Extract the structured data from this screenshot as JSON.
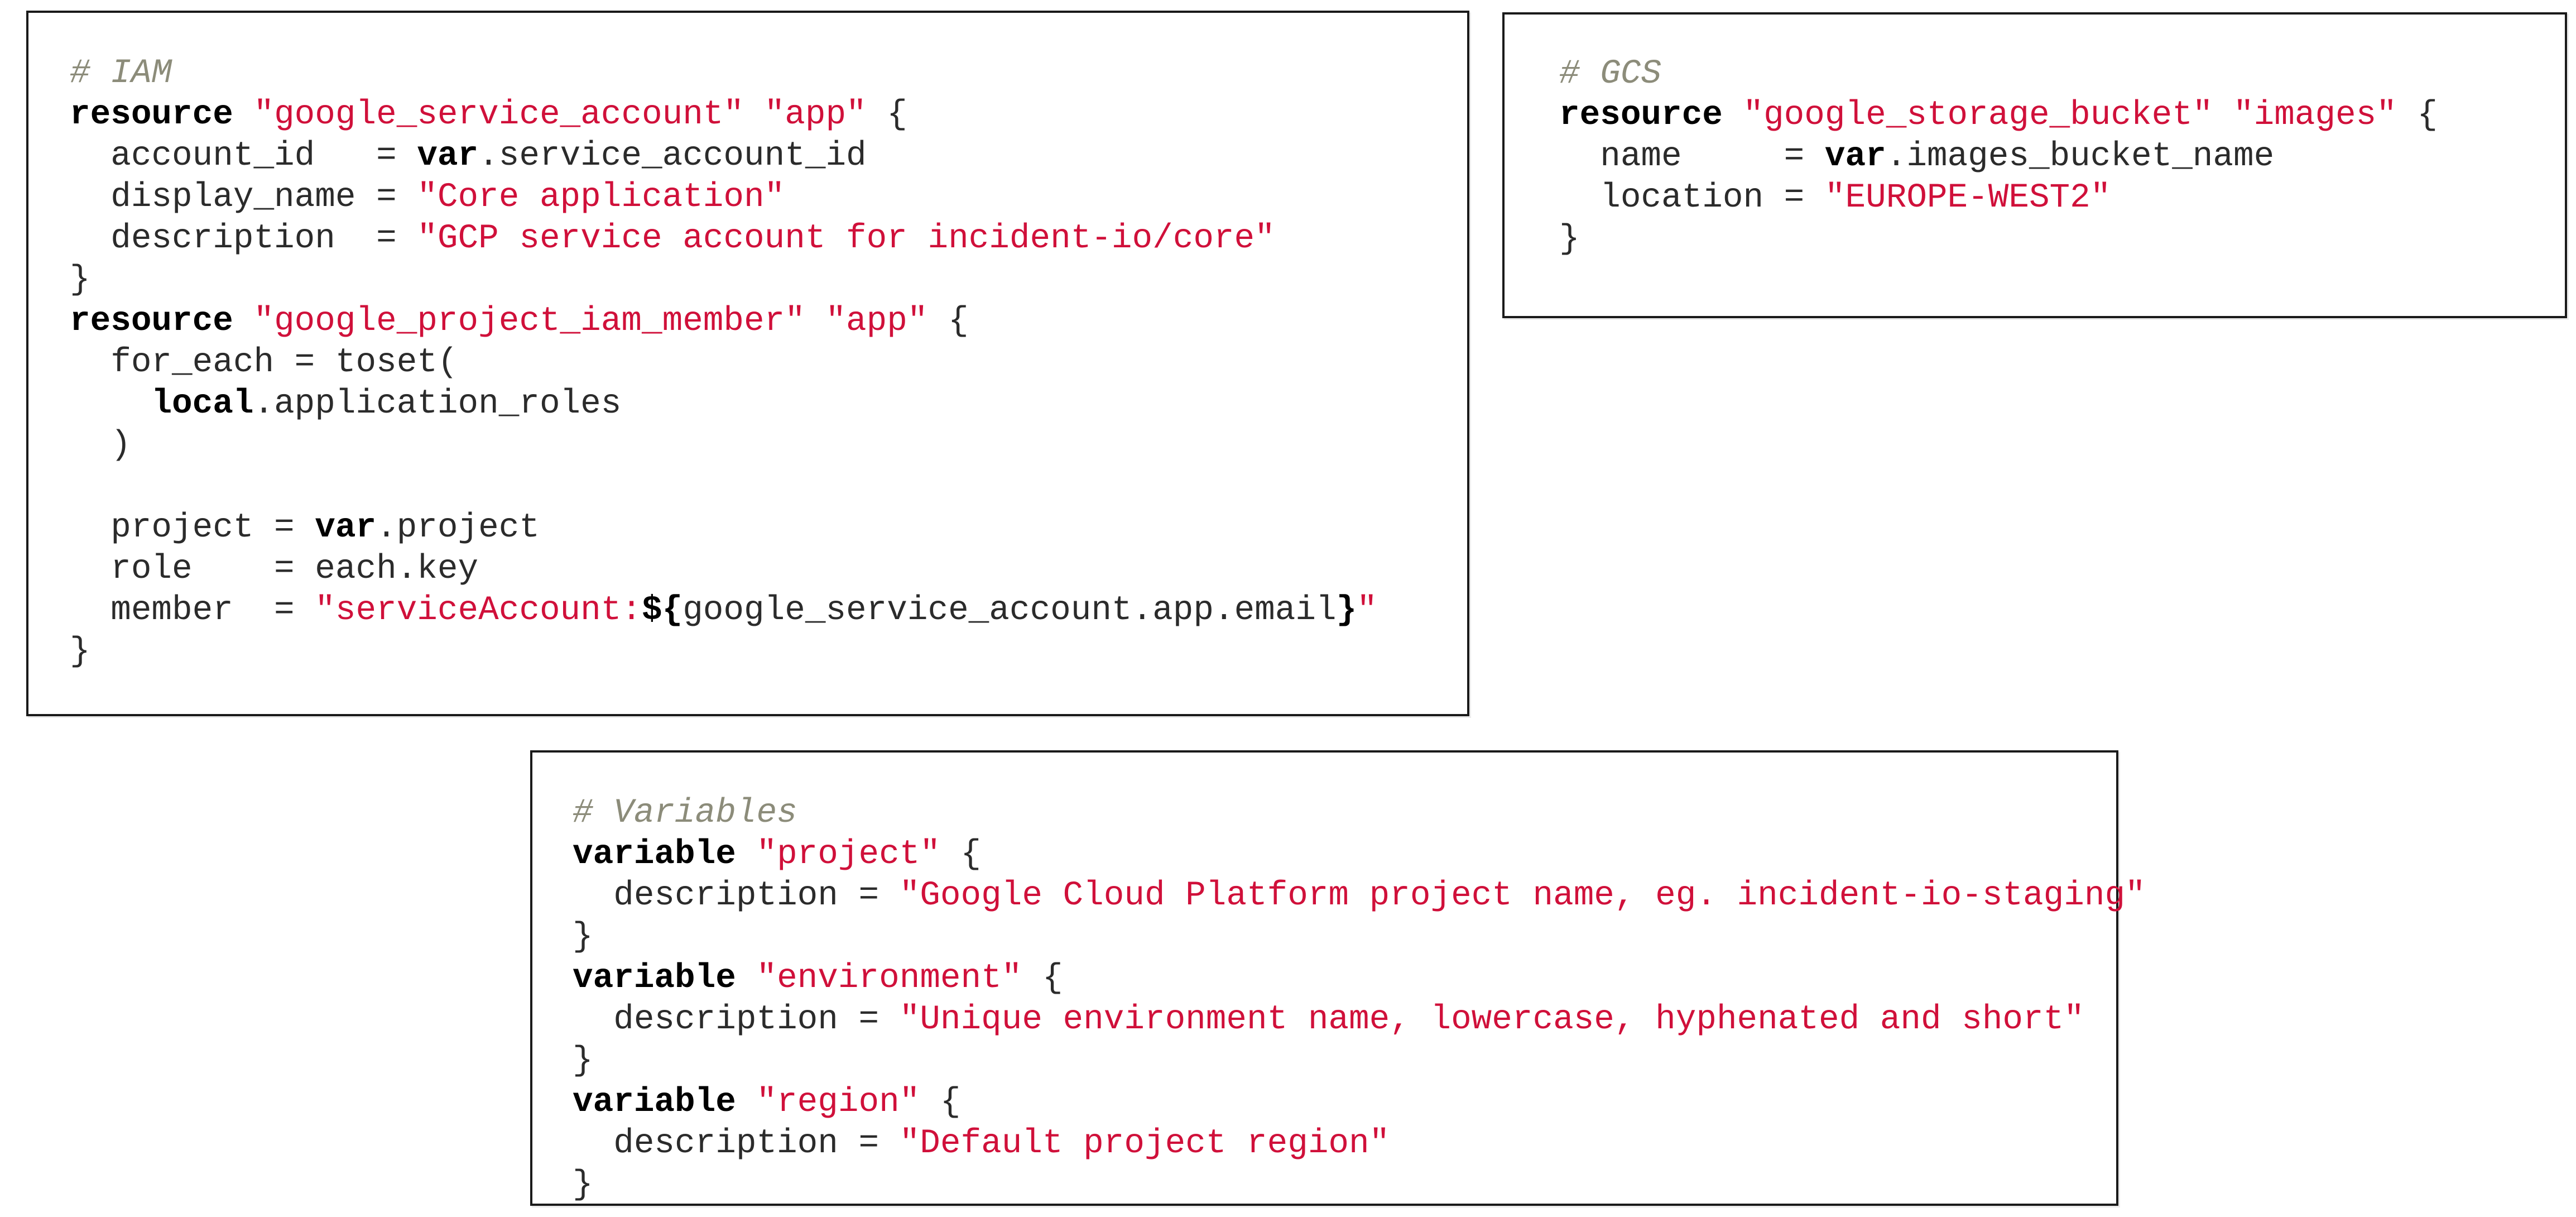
{
  "colors": {
    "comment": "#8c8c7a",
    "keyword": "#000000",
    "string": "#d0103a",
    "plain": "#2b2b2b",
    "border": "#1a1a1a"
  },
  "panels": [
    {
      "id": "iam",
      "lines": [
        [
          {
            "t": "comment",
            "v": "# IAM"
          }
        ],
        [
          {
            "t": "kw",
            "v": "resource"
          },
          {
            "t": "plain",
            "v": " "
          },
          {
            "t": "str",
            "v": "\"google_service_account\""
          },
          {
            "t": "plain",
            "v": " "
          },
          {
            "t": "str",
            "v": "\"app\""
          },
          {
            "t": "plain",
            "v": " {"
          }
        ],
        [
          {
            "t": "plain",
            "v": "  account_id   = "
          },
          {
            "t": "kw",
            "v": "var"
          },
          {
            "t": "plain",
            "v": ".service_account_id"
          }
        ],
        [
          {
            "t": "plain",
            "v": "  display_name = "
          },
          {
            "t": "str",
            "v": "\"Core application\""
          }
        ],
        [
          {
            "t": "plain",
            "v": "  description  = "
          },
          {
            "t": "str",
            "v": "\"GCP service account for incident-io/core\""
          }
        ],
        [
          {
            "t": "plain",
            "v": "}"
          }
        ],
        [
          {
            "t": "kw",
            "v": "resource"
          },
          {
            "t": "plain",
            "v": " "
          },
          {
            "t": "str",
            "v": "\"google_project_iam_member\""
          },
          {
            "t": "plain",
            "v": " "
          },
          {
            "t": "str",
            "v": "\"app\""
          },
          {
            "t": "plain",
            "v": " {"
          }
        ],
        [
          {
            "t": "plain",
            "v": "  for_each = toset("
          }
        ],
        [
          {
            "t": "plain",
            "v": "    "
          },
          {
            "t": "kw",
            "v": "local"
          },
          {
            "t": "plain",
            "v": ".application_roles"
          }
        ],
        [
          {
            "t": "plain",
            "v": "  )"
          }
        ],
        [
          {
            "t": "plain",
            "v": ""
          }
        ],
        [
          {
            "t": "plain",
            "v": "  project = "
          },
          {
            "t": "kw",
            "v": "var"
          },
          {
            "t": "plain",
            "v": ".project"
          }
        ],
        [
          {
            "t": "plain",
            "v": "  role    = each.key"
          }
        ],
        [
          {
            "t": "plain",
            "v": "  member  = "
          },
          {
            "t": "str",
            "v": "\"serviceAccount:"
          },
          {
            "t": "kw",
            "v": "${"
          },
          {
            "t": "plain",
            "v": "google_service_account.app.email"
          },
          {
            "t": "kw",
            "v": "}"
          },
          {
            "t": "str",
            "v": "\""
          }
        ],
        [
          {
            "t": "plain",
            "v": "}"
          }
        ]
      ]
    },
    {
      "id": "gcs",
      "lines": [
        [
          {
            "t": "comment",
            "v": "# GCS"
          }
        ],
        [
          {
            "t": "kw",
            "v": "resource"
          },
          {
            "t": "plain",
            "v": " "
          },
          {
            "t": "str",
            "v": "\"google_storage_bucket\""
          },
          {
            "t": "plain",
            "v": " "
          },
          {
            "t": "str",
            "v": "\"images\""
          },
          {
            "t": "plain",
            "v": " {"
          }
        ],
        [
          {
            "t": "plain",
            "v": "  name     = "
          },
          {
            "t": "kw",
            "v": "var"
          },
          {
            "t": "plain",
            "v": ".images_bucket_name"
          }
        ],
        [
          {
            "t": "plain",
            "v": "  location = "
          },
          {
            "t": "str",
            "v": "\"EUROPE-WEST2\""
          }
        ],
        [
          {
            "t": "plain",
            "v": "}"
          }
        ]
      ]
    },
    {
      "id": "vars",
      "lines": [
        [
          {
            "t": "comment",
            "v": "# Variables"
          }
        ],
        [
          {
            "t": "kw",
            "v": "variable"
          },
          {
            "t": "plain",
            "v": " "
          },
          {
            "t": "str",
            "v": "\"project\""
          },
          {
            "t": "plain",
            "v": " {"
          }
        ],
        [
          {
            "t": "plain",
            "v": "  description = "
          },
          {
            "t": "str",
            "v": "\"Google Cloud Platform project name, eg. incident-io-staging\""
          }
        ],
        [
          {
            "t": "plain",
            "v": "}"
          }
        ],
        [
          {
            "t": "kw",
            "v": "variable"
          },
          {
            "t": "plain",
            "v": " "
          },
          {
            "t": "str",
            "v": "\"environment\""
          },
          {
            "t": "plain",
            "v": " {"
          }
        ],
        [
          {
            "t": "plain",
            "v": "  description = "
          },
          {
            "t": "str",
            "v": "\"Unique environment name, lowercase, hyphenated and short\""
          }
        ],
        [
          {
            "t": "plain",
            "v": "}"
          }
        ],
        [
          {
            "t": "kw",
            "v": "variable"
          },
          {
            "t": "plain",
            "v": " "
          },
          {
            "t": "str",
            "v": "\"region\""
          },
          {
            "t": "plain",
            "v": " {"
          }
        ],
        [
          {
            "t": "plain",
            "v": "  description = "
          },
          {
            "t": "str",
            "v": "\"Default project region\""
          }
        ],
        [
          {
            "t": "plain",
            "v": "}"
          }
        ]
      ]
    }
  ]
}
